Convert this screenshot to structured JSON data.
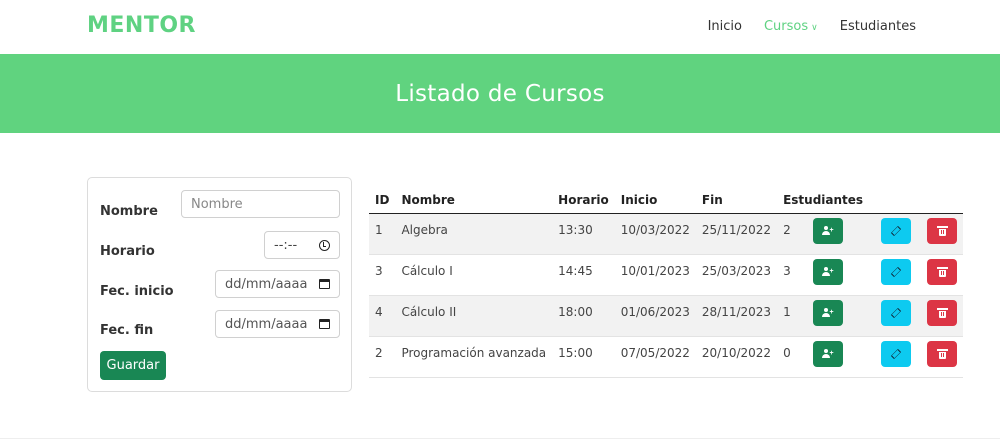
{
  "brand": "MENTOR",
  "nav": {
    "items": [
      {
        "label": "Inicio"
      },
      {
        "label": "Cursos"
      },
      {
        "label": "Estudiantes"
      }
    ],
    "dropdown_caret": "∨"
  },
  "hero": {
    "title": "Listado de Cursos"
  },
  "form": {
    "nombre_label": "Nombre",
    "nombre_placeholder": "Nombre",
    "horario_label": "Horario",
    "horario_value": "--:--",
    "inicio_label": "Fec. inicio",
    "inicio_value": "dd/mm/aaaa",
    "fin_label": "Fec. fin",
    "fin_value": "dd/mm/aaaa",
    "save_label": "Guardar"
  },
  "table": {
    "headers": [
      "ID",
      "Nombre",
      "Horario",
      "Inicio",
      "Fin",
      "Estudiantes",
      "",
      ""
    ],
    "rows": [
      {
        "id": "1",
        "nombre": "Algebra",
        "horario": "13:30",
        "inicio": "10/03/2022",
        "fin": "25/11/2022",
        "estudiantes": "2"
      },
      {
        "id": "3",
        "nombre": "Cálculo I",
        "horario": "14:45",
        "inicio": "10/01/2023",
        "fin": "25/03/2023",
        "estudiantes": "3"
      },
      {
        "id": "4",
        "nombre": "Cálculo II",
        "horario": "18:00",
        "inicio": "01/06/2023",
        "fin": "28/11/2023",
        "estudiantes": "1"
      },
      {
        "id": "2",
        "nombre": "Programación avanzada",
        "horario": "15:00",
        "inicio": "07/05/2022",
        "fin": "20/10/2022",
        "estudiantes": "0"
      }
    ]
  },
  "colors": {
    "brand": "#5fd282",
    "hero": "#60d37f",
    "add": "#198754",
    "edit": "#0dcaf0",
    "delete": "#dc3545"
  },
  "icons": {
    "add": "user-plus-icon",
    "edit": "pencil-icon",
    "delete": "trash-icon",
    "time": "clock-icon",
    "date": "calendar-icon"
  }
}
